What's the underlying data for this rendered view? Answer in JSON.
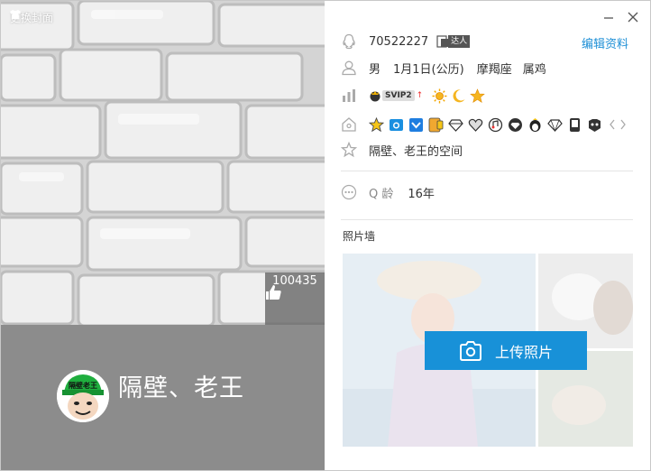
{
  "cover": {
    "change_label": "更换封面",
    "likes": "100435"
  },
  "profile": {
    "nickname": "隔壁、老王",
    "avatar_caption": "隔壁老王",
    "qq": "70522227",
    "talent_label": "达人",
    "edit_label": "编辑资料",
    "gender": "男",
    "birthday": "1月1日(公历)",
    "constellation": "摩羯座",
    "zodiac": "属鸡",
    "vip_label": "SVIP2",
    "space_label": "隔壁、老王的空间",
    "qage_label": "Q 龄",
    "qage_value": "16年"
  },
  "photos": {
    "title": "照片墙",
    "upload_label": "上传照片"
  },
  "colors": {
    "accent": "#1891d8",
    "link": "#1e8fd6",
    "namebar": "#8c8c8c"
  }
}
